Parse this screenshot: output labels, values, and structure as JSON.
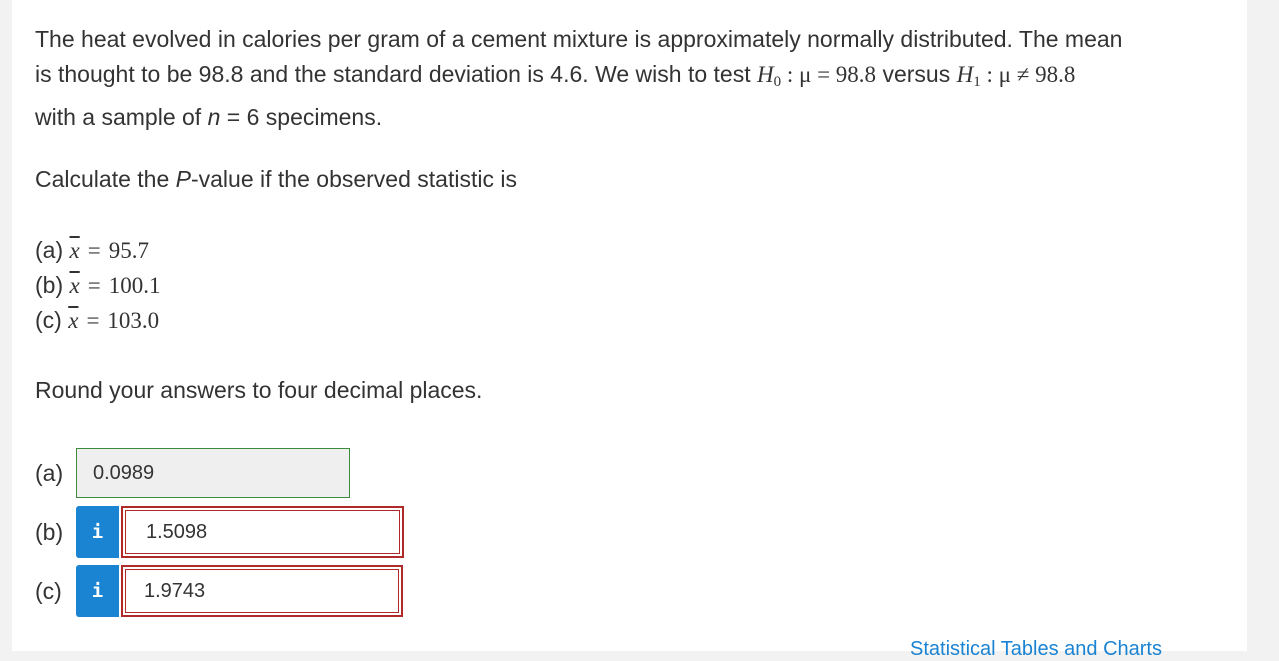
{
  "question": {
    "intro_line1": "The heat evolved in calories per gram of a cement mixture is approximately normally distributed. The mean",
    "intro_line2_a": "is thought to be 98.8 and the standard deviation is 4.6. We wish to test ",
    "h0_sym": "H",
    "h0_sub": "0",
    "h0_rest": " : μ = 98.8",
    "versus": " versus ",
    "h1_sym": "H",
    "h1_sub": "1",
    "h1_rest": " : μ ≠ 98.8",
    "intro_line3_a": "with a sample of ",
    "n_sym": "n",
    "intro_line3_b": " = 6 specimens.",
    "calc_prefix": "Calculate the ",
    "calc_p": "P",
    "calc_suffix": "-value if the observed statistic is",
    "observations": [
      {
        "label": "(a) ",
        "symbol": "x",
        "equals": "=",
        "value": "95.7"
      },
      {
        "label": "(b) ",
        "symbol": "x",
        "equals": "=",
        "value": "100.1"
      },
      {
        "label": "(c) ",
        "symbol": "x",
        "equals": "=",
        "value": "103.0"
      }
    ],
    "round_text": "Round your answers to four decimal places."
  },
  "answers": {
    "a": {
      "label": "(a)",
      "value": "0.0989"
    },
    "b": {
      "label": "(b)",
      "info": "i",
      "value": "1.5098"
    },
    "c": {
      "label": "(c)",
      "info": "i",
      "value": "1.9743"
    }
  },
  "footer": {
    "link": "Statistical Tables and Charts"
  },
  "colors": {
    "info_button": "#1a83d2",
    "error_border": "#b02a2a",
    "correct_border": "#3c8a3c"
  }
}
